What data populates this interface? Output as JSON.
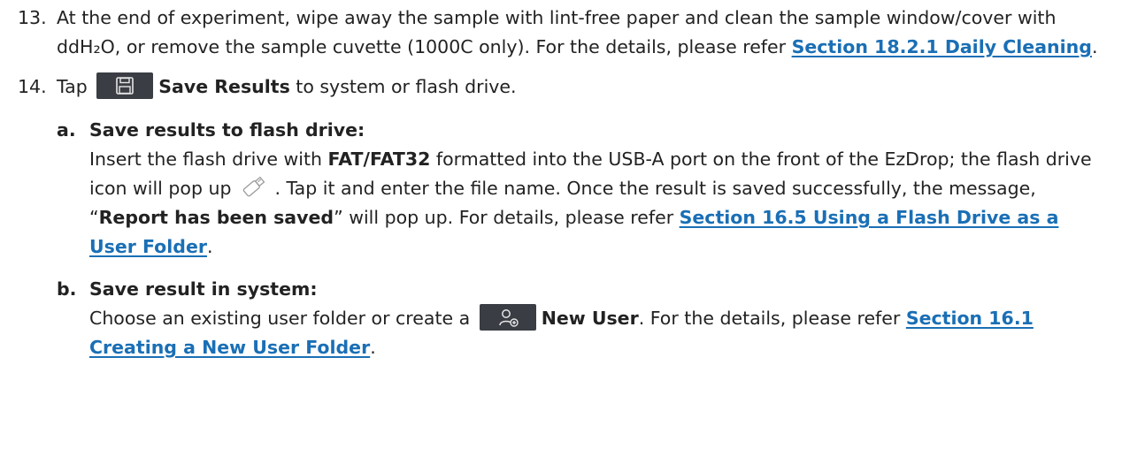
{
  "step13": {
    "number": "13.",
    "text": "At the end of experiment, wipe away the sample with lint-free paper and clean the sample window/cover with ddH₂O, or remove the sample cuvette (1000C only). For the details, please refer ",
    "link": "Section 18.2.1 Daily Cleaning",
    "end": "."
  },
  "step14": {
    "number": "14.",
    "tap": "Tap",
    "button_icon": "save-floppy-icon",
    "button_label": "Save Results",
    "rest": " to system or flash drive.",
    "substep_a": {
      "letter": "a.",
      "title": "Save results to flash drive:",
      "text1": "Insert the flash drive with ",
      "bold1": "FAT/FAT32",
      "text2": " formatted into the USB-A port on the front of the EzDrop; the flash drive icon will pop up ",
      "icon": "usb-flash-drive-icon",
      "text3": " . Tap it and enter the file name. Once the result is saved successfully, the message, “",
      "bold2": "Report has been saved",
      "text4": "” will pop up. For details, please refer ",
      "link": "Section 16.5 Using a Flash Drive as a User Folder",
      "end": "."
    },
    "substep_b": {
      "letter": "b.",
      "title": "Save result in system:",
      "text1": "Choose an existing user folder or create a ",
      "button_icon": "new-user-icon",
      "button_label": "New User",
      "text2": ". For the details, please refer ",
      "link": "Section 16.1 Creating a New User Folder",
      "end": "."
    }
  },
  "colors": {
    "text": "#222222",
    "link": "#1a6fb5",
    "button_bg": "#3a3d44",
    "icon": "#e6e6e6"
  }
}
